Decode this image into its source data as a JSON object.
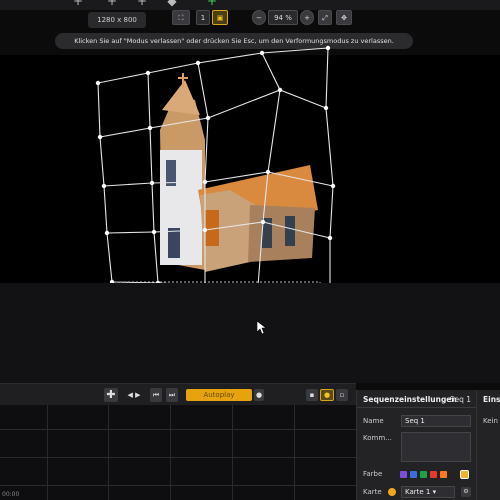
{
  "resolution_label": "1280 x 800",
  "toolbar": {
    "icons": [
      "add-node-icon",
      "add-node-icon",
      "add-node-icon",
      "arrow-icon",
      "add-green-icon"
    ],
    "page_value": "1",
    "zoom_value": "94 %"
  },
  "hint": "Klicken Sie auf \"Modus verlassen\" oder drücken Sie Esc, um den Verformungsmodus zu verlassen.",
  "timeline": {
    "autoplay_label": "Autoplay"
  },
  "panel": {
    "title": "Sequenzeinstellungen",
    "seq": "Seq 1",
    "name_label": "Name",
    "name_value": "Seq 1",
    "comment_label": "Komm...",
    "color_label": "Farbe",
    "map_label": "Karte",
    "map_value": "Karte 1",
    "colors": [
      "#7b4fd6",
      "#3a6ee0",
      "#1fa14a",
      "#e23a2e",
      "#ff7a1a",
      "#222222",
      "#f0b429"
    ]
  },
  "panel2": {
    "title": "Einst",
    "label": "Kein"
  },
  "bottom_left": "00:00"
}
